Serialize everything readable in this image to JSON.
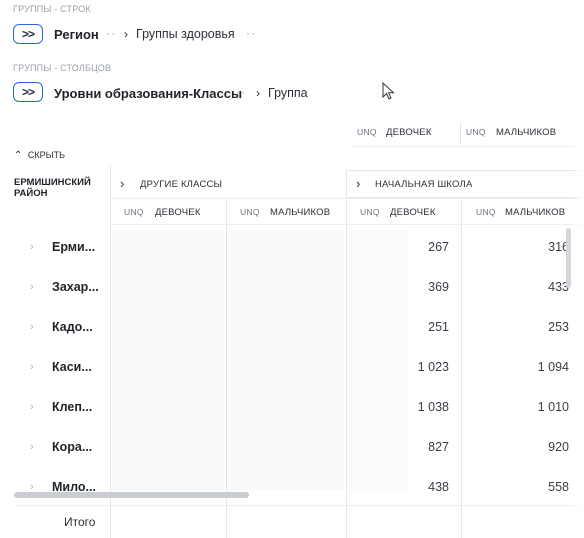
{
  "rows_section": {
    "label": "ГРУППЫ - СТРОК",
    "toggle": ">>",
    "region": "Регион",
    "group": "Группы здоровья"
  },
  "cols_section": {
    "label": "ГРУППЫ - СТОЛБЦОВ",
    "toggle": ">>",
    "levels": "Уровни образования-Классы",
    "group": "Группа"
  },
  "top_columns": [
    {
      "unq": "UNQ",
      "label": "ДЕВОЧЕК"
    },
    {
      "unq": "UNQ",
      "label": "МАЛЬЧИКОВ"
    }
  ],
  "hide_label": "СКРЫТЬ",
  "region_name": "ЕРМИШИНСКИЙ РАЙОН",
  "groups": [
    {
      "label": "ДРУГИЕ КЛАССЫ"
    },
    {
      "label": "НАЧАЛЬНАЯ ШКОЛА"
    }
  ],
  "sub_columns": [
    {
      "unq": "UNQ",
      "label": "ДЕВОЧЕК"
    },
    {
      "unq": "UNQ",
      "label": "МАЛЬЧИКОВ"
    },
    {
      "unq": "UNQ",
      "label": "ДЕВОЧЕК"
    },
    {
      "unq": "UNQ",
      "label": "МАЛЬЧИКОВ"
    }
  ],
  "rows": [
    {
      "name": "Ерми...",
      "girls": "267",
      "boys": "316"
    },
    {
      "name": "Захар...",
      "girls": "369",
      "boys": "433"
    },
    {
      "name": "Кадо...",
      "girls": "251",
      "boys": "253"
    },
    {
      "name": "Каси...",
      "girls": "1 023",
      "boys": "1 094"
    },
    {
      "name": "Клеп...",
      "girls": "1 038",
      "boys": "1 010"
    },
    {
      "name": "Кора...",
      "girls": "827",
      "boys": "920"
    },
    {
      "name": "Мило...",
      "girls": "438",
      "boys": "558"
    }
  ],
  "total_label": "Итого"
}
